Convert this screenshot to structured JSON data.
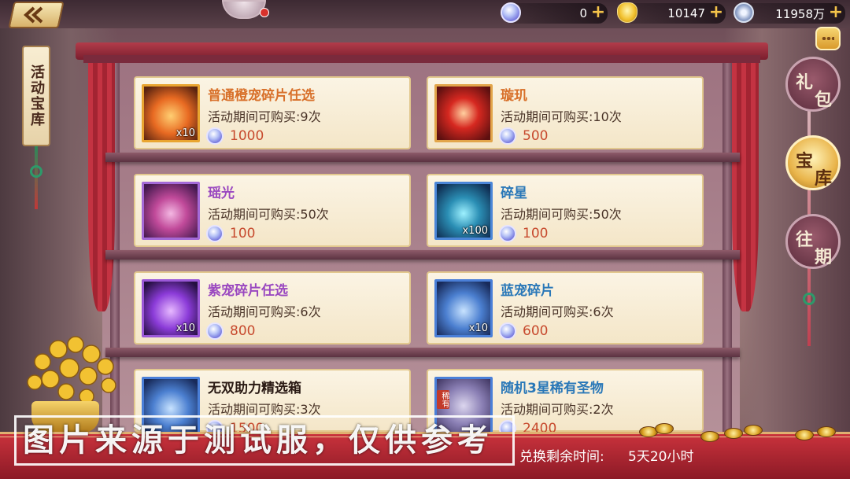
{
  "header": {
    "currencies": [
      {
        "icon": "diamond-gem-icon",
        "value": "0"
      },
      {
        "icon": "gold-ingot-icon",
        "value": "10147"
      },
      {
        "icon": "copper-coin-icon",
        "value": "11958万"
      }
    ],
    "plus_icon": "+"
  },
  "left_tag": {
    "label": "活动宝库"
  },
  "right_tabs": [
    {
      "label_a": "礼",
      "label_b": "包"
    },
    {
      "label_a": "宝",
      "label_b": "库"
    },
    {
      "label_a": "往",
      "label_b": "期"
    }
  ],
  "items": [
    {
      "name": "普通橙宠碎片任选",
      "limit": "活动期间可购买:9次",
      "price": "1000",
      "qty": "x10",
      "rarity": "orange"
    },
    {
      "name": "璇玑",
      "limit": "活动期间可购买:10次",
      "price": "500",
      "qty": "",
      "rarity": "orange"
    },
    {
      "name": "瑶光",
      "limit": "活动期间可购买:50次",
      "price": "100",
      "qty": "",
      "rarity": "purple"
    },
    {
      "name": "碎星",
      "limit": "活动期间可购买:50次",
      "price": "100",
      "qty": "x100",
      "rarity": "blue"
    },
    {
      "name": "紫宠碎片任选",
      "limit": "活动期间可购买:6次",
      "price": "800",
      "qty": "x10",
      "rarity": "purple"
    },
    {
      "name": "蓝宠碎片",
      "limit": "活动期间可购买:6次",
      "price": "600",
      "qty": "x10",
      "rarity": "blue"
    },
    {
      "name": "无双助力精选箱",
      "limit": "活动期间可购买:3次",
      "price": "1500",
      "qty": "",
      "rarity": "plain"
    },
    {
      "name": "随机3星稀有圣物",
      "limit": "活动期间可购买:2次",
      "price": "2400",
      "qty": "",
      "rarity": "blue",
      "badge": "稀有"
    }
  ],
  "footer": {
    "timer_label": "兑换剩余时间:",
    "timer_value": "5天20小时"
  },
  "watermark": "图片来源于测试服，仅供参考",
  "colors": {
    "orange_name": "#d8702a",
    "purple_name": "#9a48c0",
    "blue_name": "#2a78b8",
    "price": "#c74a2e",
    "accent_gold": "#f4c34a"
  }
}
